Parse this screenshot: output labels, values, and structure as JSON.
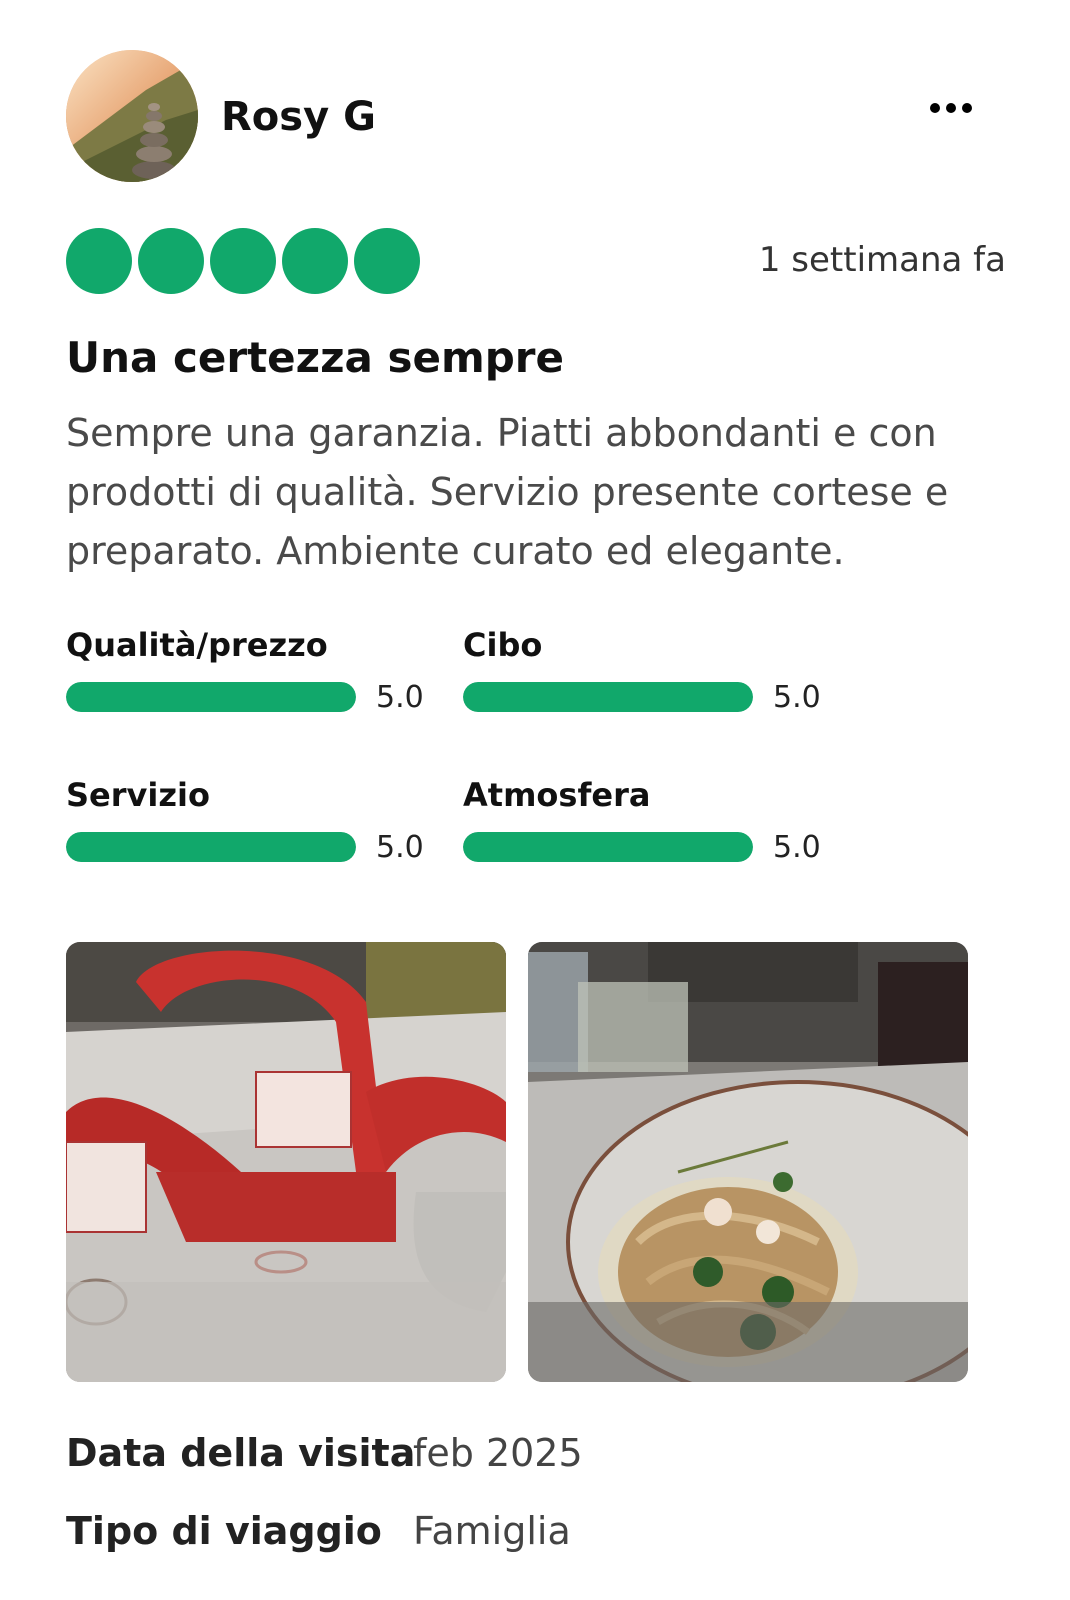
{
  "review": {
    "author": "Rosy G",
    "bubble_rating": 5,
    "bubble_max": 5,
    "posted": "1 settimana fa",
    "title": "Una certezza sempre",
    "text": "Sempre una garanzia. Piatti abbondanti e con prodotti di qualità. Servizio presente cortese e preparato. Ambiente curato ed elegante."
  },
  "subratings": [
    {
      "label": "Qualità/prezzo",
      "score": "5.0",
      "fraction": 1.0
    },
    {
      "label": "Cibo",
      "score": "5.0",
      "fraction": 1.0
    },
    {
      "label": "Servizio",
      "score": "5.0",
      "fraction": 1.0
    },
    {
      "label": "Atmosfera",
      "score": "5.0",
      "fraction": 1.0
    }
  ],
  "visit": {
    "date_label": "Data della visita",
    "date_value": "feb 2025",
    "trip_label": "Tipo di viaggio",
    "trip_value": "Famiglia"
  },
  "colors": {
    "accent": "#11a86b"
  },
  "icons": {
    "more": "more-horizontal-icon"
  }
}
